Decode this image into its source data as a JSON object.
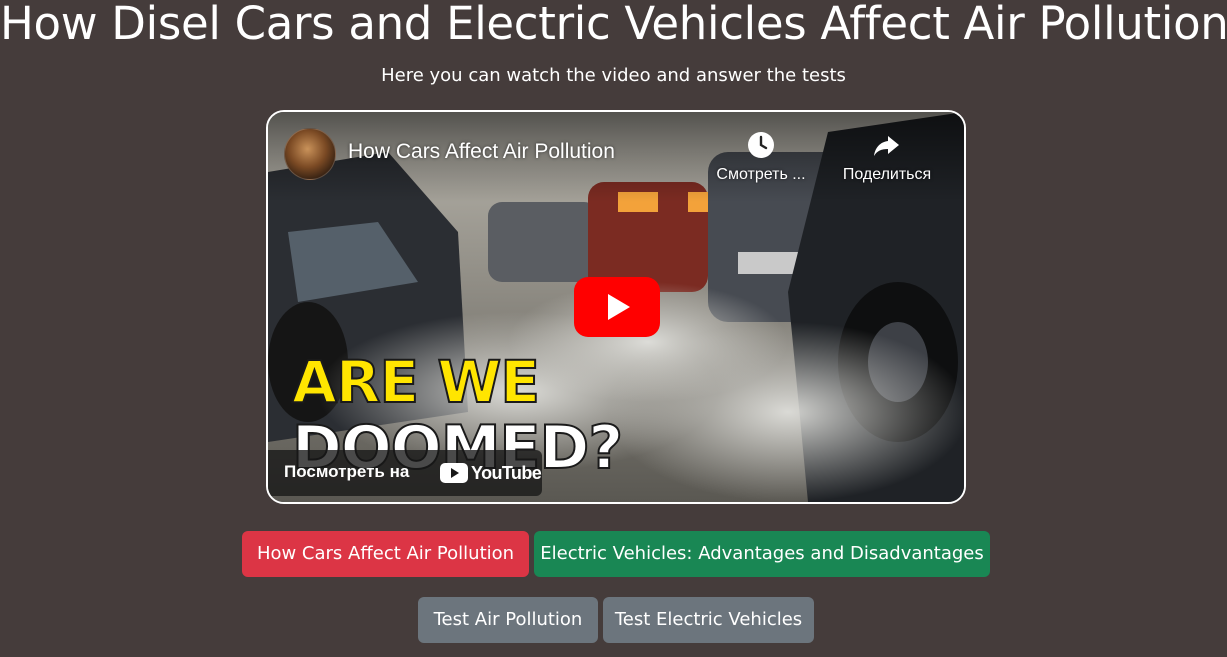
{
  "header": {
    "title": "How Disel Cars and Electric Vehicles Affect Air Pollution",
    "subtitle": "Here you can watch the video and answer the tests"
  },
  "video": {
    "title": "How Cars Affect Air Pollution",
    "watch_later_label": "Смотреть ...",
    "share_label": "Поделиться",
    "watch_on_label": "Посмотреть на",
    "youtube_logo_text": "YouTube",
    "thumbnail_text_line1": "ARE WE",
    "thumbnail_text_line2": "DOOMED?",
    "icons": {
      "watch_later": "clock-icon",
      "share": "share-arrow-icon",
      "play": "youtube-play-icon"
    },
    "colors": {
      "play_button": "#ff0000",
      "thumbnail_headline": "#ffe500"
    }
  },
  "buttons": {
    "topic_cars": "How Cars Affect Air Pollution",
    "topic_ev": "Electric Vehicles: Advantages and Disadvantages",
    "test_air": "Test Air Pollution",
    "test_ev": "Test Electric Vehicles"
  },
  "colors": {
    "background": "#453c3b",
    "red_button": "#dc3545",
    "green_button": "#198754",
    "gray_button": "#6c757d"
  }
}
